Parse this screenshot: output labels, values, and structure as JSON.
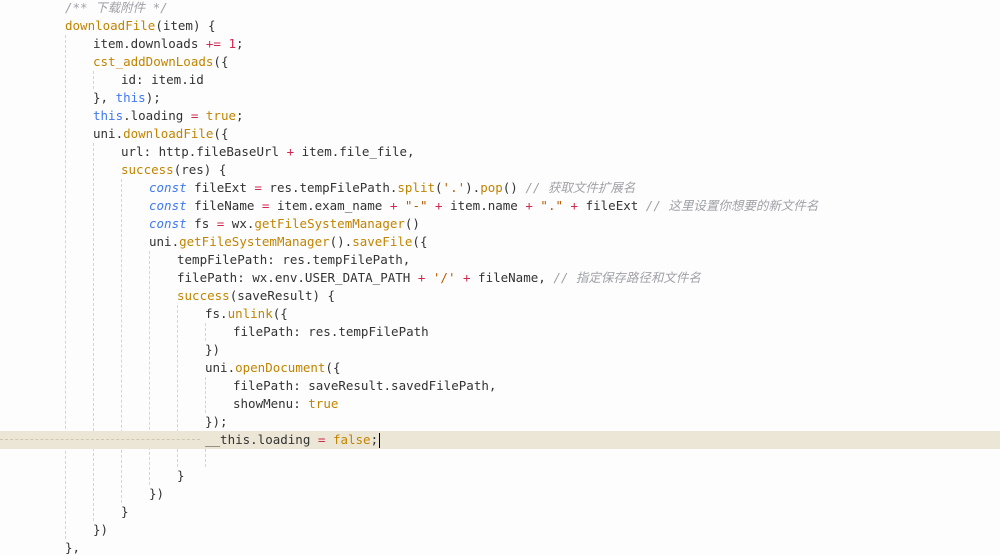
{
  "editor": {
    "language": "javascript",
    "cursor_line_index": 24,
    "colors": {
      "background": "#fdfdfd",
      "current_line": "#ece6d6",
      "comment": "#a0a1a7",
      "function": "#c18401",
      "keyword": "#4078f2",
      "string": "#b75a00",
      "number": "#d1284e",
      "default": "#333333"
    },
    "lines": [
      {
        "indent": 2,
        "tokens": [
          {
            "t": "/** 下载附件 */",
            "c": "cmt"
          }
        ]
      },
      {
        "indent": 2,
        "tokens": [
          {
            "t": "downloadFile",
            "c": "fn"
          },
          {
            "t": "(item) {",
            "c": ""
          }
        ]
      },
      {
        "indent": 3,
        "tokens": [
          {
            "t": "item.downloads ",
            "c": ""
          },
          {
            "t": "+=",
            "c": "op"
          },
          {
            "t": " ",
            "c": ""
          },
          {
            "t": "1",
            "c": "num"
          },
          {
            "t": ";",
            "c": ""
          }
        ]
      },
      {
        "indent": 3,
        "tokens": [
          {
            "t": "cst_addDownLoads",
            "c": "fn"
          },
          {
            "t": "({",
            "c": ""
          }
        ]
      },
      {
        "indent": 4,
        "tokens": [
          {
            "t": "id: item.id",
            "c": ""
          }
        ]
      },
      {
        "indent": 3,
        "tokens": [
          {
            "t": "}, ",
            "c": ""
          },
          {
            "t": "this",
            "c": "kw2"
          },
          {
            "t": ");",
            "c": ""
          }
        ]
      },
      {
        "indent": 3,
        "tokens": [
          {
            "t": "this",
            "c": "kw2"
          },
          {
            "t": ".loading ",
            "c": ""
          },
          {
            "t": "=",
            "c": "op"
          },
          {
            "t": " ",
            "c": ""
          },
          {
            "t": "true",
            "c": "bool"
          },
          {
            "t": ";",
            "c": ""
          }
        ]
      },
      {
        "indent": 3,
        "tokens": [
          {
            "t": "uni.",
            "c": ""
          },
          {
            "t": "downloadFile",
            "c": "fn"
          },
          {
            "t": "({",
            "c": ""
          }
        ]
      },
      {
        "indent": 4,
        "tokens": [
          {
            "t": "url: http.fileBaseUrl ",
            "c": ""
          },
          {
            "t": "+",
            "c": "op"
          },
          {
            "t": " item.file_file,",
            "c": ""
          }
        ]
      },
      {
        "indent": 4,
        "tokens": [
          {
            "t": "success",
            "c": "fn"
          },
          {
            "t": "(res) {",
            "c": ""
          }
        ]
      },
      {
        "indent": 5,
        "tokens": [
          {
            "t": "const",
            "c": "kw"
          },
          {
            "t": " fileExt ",
            "c": ""
          },
          {
            "t": "=",
            "c": "op"
          },
          {
            "t": " res.tempFilePath.",
            "c": ""
          },
          {
            "t": "split",
            "c": "fn"
          },
          {
            "t": "(",
            "c": ""
          },
          {
            "t": "'.'",
            "c": "str"
          },
          {
            "t": ").",
            "c": ""
          },
          {
            "t": "pop",
            "c": "fn"
          },
          {
            "t": "() ",
            "c": ""
          },
          {
            "t": "// 获取文件扩展名",
            "c": "cmt"
          }
        ]
      },
      {
        "indent": 5,
        "tokens": [
          {
            "t": "const",
            "c": "kw"
          },
          {
            "t": " fileName ",
            "c": ""
          },
          {
            "t": "=",
            "c": "op"
          },
          {
            "t": " item.exam_name ",
            "c": ""
          },
          {
            "t": "+",
            "c": "op"
          },
          {
            "t": " ",
            "c": ""
          },
          {
            "t": "\"-\"",
            "c": "str"
          },
          {
            "t": " ",
            "c": ""
          },
          {
            "t": "+",
            "c": "op"
          },
          {
            "t": " item.name ",
            "c": ""
          },
          {
            "t": "+",
            "c": "op"
          },
          {
            "t": " ",
            "c": ""
          },
          {
            "t": "\".\"",
            "c": "str"
          },
          {
            "t": " ",
            "c": ""
          },
          {
            "t": "+",
            "c": "op"
          },
          {
            "t": " fileExt ",
            "c": ""
          },
          {
            "t": "// 这里设置你想要的新文件名",
            "c": "cmt"
          }
        ]
      },
      {
        "indent": 5,
        "tokens": [
          {
            "t": "const",
            "c": "kw"
          },
          {
            "t": " fs ",
            "c": ""
          },
          {
            "t": "=",
            "c": "op"
          },
          {
            "t": " wx.",
            "c": ""
          },
          {
            "t": "getFileSystemManager",
            "c": "fn"
          },
          {
            "t": "()",
            "c": ""
          }
        ]
      },
      {
        "indent": 5,
        "tokens": [
          {
            "t": "uni.",
            "c": ""
          },
          {
            "t": "getFileSystemManager",
            "c": "fn"
          },
          {
            "t": "().",
            "c": ""
          },
          {
            "t": "saveFile",
            "c": "fn"
          },
          {
            "t": "({",
            "c": ""
          }
        ]
      },
      {
        "indent": 6,
        "tokens": [
          {
            "t": "tempFilePath: res.tempFilePath,",
            "c": ""
          }
        ]
      },
      {
        "indent": 6,
        "tokens": [
          {
            "t": "filePath: wx.env.USER_DATA_PATH ",
            "c": ""
          },
          {
            "t": "+",
            "c": "op"
          },
          {
            "t": " ",
            "c": ""
          },
          {
            "t": "'/'",
            "c": "str"
          },
          {
            "t": " ",
            "c": ""
          },
          {
            "t": "+",
            "c": "op"
          },
          {
            "t": " fileName, ",
            "c": ""
          },
          {
            "t": "// 指定保存路径和文件名",
            "c": "cmt"
          }
        ]
      },
      {
        "indent": 6,
        "tokens": [
          {
            "t": "success",
            "c": "fn"
          },
          {
            "t": "(saveResult) {",
            "c": ""
          }
        ]
      },
      {
        "indent": 7,
        "tokens": [
          {
            "t": "fs.",
            "c": ""
          },
          {
            "t": "unlink",
            "c": "fn"
          },
          {
            "t": "({",
            "c": ""
          }
        ]
      },
      {
        "indent": 8,
        "tokens": [
          {
            "t": "filePath: res.tempFilePath",
            "c": ""
          }
        ]
      },
      {
        "indent": 7,
        "tokens": [
          {
            "t": "})",
            "c": ""
          }
        ]
      },
      {
        "indent": 7,
        "tokens": [
          {
            "t": "uni.",
            "c": ""
          },
          {
            "t": "openDocument",
            "c": "fn"
          },
          {
            "t": "({",
            "c": ""
          }
        ]
      },
      {
        "indent": 8,
        "tokens": [
          {
            "t": "filePath: saveResult.savedFilePath,",
            "c": ""
          }
        ]
      },
      {
        "indent": 8,
        "tokens": [
          {
            "t": "showMenu: ",
            "c": ""
          },
          {
            "t": "true",
            "c": "bool"
          }
        ]
      },
      {
        "indent": 7,
        "tokens": [
          {
            "t": "});",
            "c": ""
          }
        ]
      },
      {
        "indent": 7,
        "tokens": [
          {
            "t": "__this.loading ",
            "c": ""
          },
          {
            "t": "=",
            "c": "op"
          },
          {
            "t": " ",
            "c": ""
          },
          {
            "t": "false",
            "c": "bool"
          },
          {
            "t": ";",
            "c": ""
          }
        ]
      },
      {
        "indent": 0,
        "tokens": []
      },
      {
        "indent": 6,
        "tokens": [
          {
            "t": "}",
            "c": ""
          }
        ]
      },
      {
        "indent": 5,
        "tokens": [
          {
            "t": "})",
            "c": ""
          }
        ]
      },
      {
        "indent": 4,
        "tokens": [
          {
            "t": "}",
            "c": ""
          }
        ]
      },
      {
        "indent": 3,
        "tokens": [
          {
            "t": "})",
            "c": ""
          }
        ]
      },
      {
        "indent": 2,
        "tokens": [
          {
            "t": "},",
            "c": ""
          }
        ]
      }
    ]
  }
}
